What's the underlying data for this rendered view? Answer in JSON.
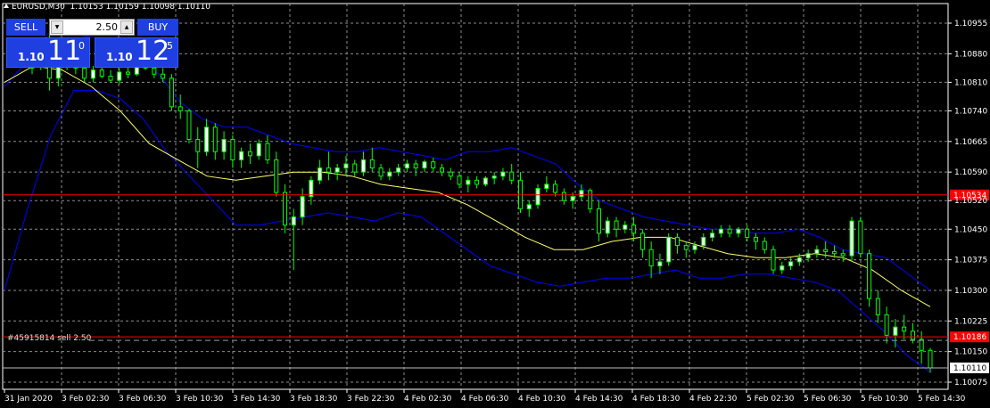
{
  "window": {
    "title": "EURUSD,M30  1.10153 1.10159 1.10098 1.10110"
  },
  "trade_panel": {
    "sell_label": "SELL",
    "buy_label": "BUY",
    "lot_value": "2.50",
    "sell_price": {
      "prefix": "1.10",
      "big": "11",
      "sup": "0"
    },
    "buy_price": {
      "prefix": "1.10",
      "big": "12",
      "sup": "5"
    }
  },
  "colors": {
    "background": "#000000",
    "grid": "#8c8c8c",
    "bull_candle": "#ffffff",
    "bear_candle": "#000000",
    "candle_outline": "#00ff00",
    "bollinger": "#0000ff",
    "moving_average": "#ffff66",
    "order_line": "#ff0000",
    "button": "#1f3fe0"
  },
  "chart_data": {
    "type": "candlestick",
    "symbol": "EURUSD",
    "timeframe": "M30",
    "ylim": [
      1.10075,
      1.10955
    ],
    "y_ticks": [
      "1.10955",
      "1.10880",
      "1.10810",
      "1.10740",
      "1.10665",
      "1.10590",
      "1.10520",
      "1.10450",
      "1.10375",
      "1.10300",
      "1.10225",
      "1.10150",
      "1.10075"
    ],
    "x_ticks": [
      "31 Jan 2020",
      "3 Feb 02:30",
      "3 Feb 06:30",
      "3 Feb 10:30",
      "3 Feb 14:30",
      "3 Feb 18:30",
      "3 Feb 22:30",
      "4 Feb 02:30",
      "4 Feb 06:30",
      "4 Feb 10:30",
      "4 Feb 14:30",
      "4 Feb 18:30",
      "4 Feb 22:30",
      "5 Feb 02:30",
      "5 Feb 06:30",
      "5 Feb 10:30",
      "5 Feb 14:30"
    ],
    "grid": true,
    "price_tags": [
      {
        "value": 1.10534,
        "label": "1.10534",
        "kind": "order-line"
      },
      {
        "value": 1.10186,
        "label": "1.10186",
        "kind": "order-line"
      },
      {
        "value": 1.1011,
        "label": "1.10110",
        "kind": "bid"
      }
    ],
    "order_label": "#45915814 sell 2.50",
    "candles": [
      [
        1.10845,
        1.1086,
        1.1083,
        1.1085
      ],
      [
        1.1085,
        1.10865,
        1.1084,
        1.10858
      ],
      [
        1.10875,
        1.10955,
        1.1079,
        1.1082
      ],
      [
        1.1082,
        1.1089,
        1.108,
        1.1087
      ],
      [
        1.1087,
        1.1088,
        1.1084,
        1.10855
      ],
      [
        1.10855,
        1.1087,
        1.1083,
        1.10845
      ],
      [
        1.10845,
        1.1086,
        1.1081,
        1.1082
      ],
      [
        1.1082,
        1.1085,
        1.1081,
        1.1084
      ],
      [
        1.1084,
        1.1085,
        1.1082,
        1.10825
      ],
      [
        1.10825,
        1.1084,
        1.1081,
        1.10815
      ],
      [
        1.10815,
        1.10845,
        1.10805,
        1.10835
      ],
      [
        1.10835,
        1.1086,
        1.1082,
        1.1083
      ],
      [
        1.1083,
        1.1087,
        1.10825,
        1.1086
      ],
      [
        1.1086,
        1.1087,
        1.1084,
        1.10845
      ],
      [
        1.10845,
        1.10855,
        1.1082,
        1.1083
      ],
      [
        1.1083,
        1.10845,
        1.1081,
        1.1082
      ],
      [
        1.1082,
        1.1083,
        1.1074,
        1.1075
      ],
      [
        1.1075,
        1.1078,
        1.1072,
        1.1074
      ],
      [
        1.1074,
        1.10745,
        1.1066,
        1.1067
      ],
      [
        1.1067,
        1.107,
        1.106,
        1.1064
      ],
      [
        1.1064,
        1.1072,
        1.1063,
        1.107
      ],
      [
        1.107,
        1.1071,
        1.1062,
        1.1064
      ],
      [
        1.1064,
        1.1069,
        1.1062,
        1.1067
      ],
      [
        1.1067,
        1.1068,
        1.106,
        1.1062
      ],
      [
        1.1062,
        1.1065,
        1.106,
        1.1064
      ],
      [
        1.1064,
        1.1066,
        1.1061,
        1.1063
      ],
      [
        1.1063,
        1.1067,
        1.1062,
        1.1066
      ],
      [
        1.1066,
        1.1068,
        1.1061,
        1.1062
      ],
      [
        1.1062,
        1.1064,
        1.1053,
        1.1054
      ],
      [
        1.1054,
        1.1056,
        1.1044,
        1.1046
      ],
      [
        1.1046,
        1.105,
        1.1035,
        1.1048
      ],
      [
        1.1048,
        1.1055,
        1.1046,
        1.1053
      ],
      [
        1.1053,
        1.1058,
        1.1051,
        1.1057
      ],
      [
        1.1057,
        1.1062,
        1.1056,
        1.106
      ],
      [
        1.106,
        1.1064,
        1.1057,
        1.1059
      ],
      [
        1.1059,
        1.1061,
        1.1057,
        1.106
      ],
      [
        1.106,
        1.1063,
        1.1058,
        1.1061
      ],
      [
        1.1061,
        1.1062,
        1.1058,
        1.1059
      ],
      [
        1.1059,
        1.1064,
        1.1058,
        1.1062
      ],
      [
        1.1062,
        1.1065,
        1.1059,
        1.106
      ],
      [
        1.106,
        1.1061,
        1.1057,
        1.1058
      ],
      [
        1.1058,
        1.106,
        1.1057,
        1.1059
      ],
      [
        1.1059,
        1.1061,
        1.1058,
        1.106
      ],
      [
        1.106,
        1.1062,
        1.1059,
        1.1061
      ],
      [
        1.1061,
        1.1062,
        1.1058,
        1.106
      ],
      [
        1.106,
        1.1062,
        1.1059,
        1.10615
      ],
      [
        1.10615,
        1.10625,
        1.1059,
        1.106
      ],
      [
        1.106,
        1.1061,
        1.1058,
        1.1059
      ],
      [
        1.1059,
        1.106,
        1.1057,
        1.1058
      ],
      [
        1.1058,
        1.1059,
        1.1055,
        1.1056
      ],
      [
        1.1056,
        1.1058,
        1.1054,
        1.1057
      ],
      [
        1.1057,
        1.1058,
        1.1055,
        1.1056
      ],
      [
        1.1056,
        1.1058,
        1.10555,
        1.10575
      ],
      [
        1.10575,
        1.1059,
        1.1056,
        1.1058
      ],
      [
        1.1058,
        1.106,
        1.1057,
        1.1059
      ],
      [
        1.1059,
        1.1061,
        1.1056,
        1.1057
      ],
      [
        1.1057,
        1.1059,
        1.1049,
        1.105
      ],
      [
        1.105,
        1.1052,
        1.1048,
        1.1051
      ],
      [
        1.1051,
        1.1056,
        1.105,
        1.1055
      ],
      [
        1.1055,
        1.1058,
        1.1054,
        1.1056
      ],
      [
        1.1056,
        1.1057,
        1.1053,
        1.1054
      ],
      [
        1.1054,
        1.1055,
        1.1051,
        1.1052
      ],
      [
        1.1052,
        1.1054,
        1.105,
        1.1053
      ],
      [
        1.1053,
        1.1056,
        1.1052,
        1.10545
      ],
      [
        1.10545,
        1.1055,
        1.1049,
        1.105
      ],
      [
        1.105,
        1.1052,
        1.1042,
        1.1044
      ],
      [
        1.1044,
        1.1048,
        1.1043,
        1.1047
      ],
      [
        1.1047,
        1.1048,
        1.1043,
        1.1045
      ],
      [
        1.1045,
        1.1047,
        1.1044,
        1.1046
      ],
      [
        1.1046,
        1.1048,
        1.1042,
        1.1044
      ],
      [
        1.1044,
        1.1045,
        1.1038,
        1.104
      ],
      [
        1.104,
        1.1042,
        1.1033,
        1.1036
      ],
      [
        1.1036,
        1.1039,
        1.1034,
        1.1037
      ],
      [
        1.1037,
        1.1044,
        1.1036,
        1.1043
      ],
      [
        1.1043,
        1.1044,
        1.1039,
        1.1041
      ],
      [
        1.1041,
        1.1042,
        1.1038,
        1.104
      ],
      [
        1.104,
        1.1042,
        1.1039,
        1.1041
      ],
      [
        1.1041,
        1.1044,
        1.104,
        1.1043
      ],
      [
        1.1043,
        1.1045,
        1.1042,
        1.1044
      ],
      [
        1.1044,
        1.1046,
        1.1043,
        1.1045
      ],
      [
        1.1045,
        1.1046,
        1.1043,
        1.1044
      ],
      [
        1.1044,
        1.10455,
        1.1043,
        1.1045
      ],
      [
        1.1045,
        1.1046,
        1.1042,
        1.1043
      ],
      [
        1.1043,
        1.1044,
        1.104,
        1.1042
      ],
      [
        1.1042,
        1.1043,
        1.1039,
        1.104
      ],
      [
        1.104,
        1.1041,
        1.1034,
        1.1035
      ],
      [
        1.1035,
        1.1037,
        1.1034,
        1.1036
      ],
      [
        1.1036,
        1.1038,
        1.1035,
        1.1037
      ],
      [
        1.1037,
        1.1039,
        1.1036,
        1.1038
      ],
      [
        1.1038,
        1.104,
        1.1037,
        1.1039
      ],
      [
        1.1039,
        1.1041,
        1.1038,
        1.104
      ],
      [
        1.104,
        1.1042,
        1.1038,
        1.10395
      ],
      [
        1.10395,
        1.1041,
        1.1038,
        1.1039
      ],
      [
        1.1039,
        1.104,
        1.1037,
        1.10385
      ],
      [
        1.10385,
        1.1048,
        1.1037,
        1.1047
      ],
      [
        1.1047,
        1.1048,
        1.1038,
        1.1039
      ],
      [
        1.1039,
        1.104,
        1.1026,
        1.1028
      ],
      [
        1.1028,
        1.103,
        1.1022,
        1.1024
      ],
      [
        1.1024,
        1.1026,
        1.1017,
        1.1019
      ],
      [
        1.1019,
        1.1023,
        1.1016,
        1.1021
      ],
      [
        1.1021,
        1.1024,
        1.1018,
        1.102
      ],
      [
        1.102,
        1.1022,
        1.1017,
        1.1018
      ],
      [
        1.1018,
        1.102,
        1.1012,
        1.10153
      ],
      [
        1.10153,
        1.10159,
        1.10098,
        1.1011
      ]
    ],
    "bollinger_upper": [
      1.108,
      1.1086,
      1.1093,
      1.1093,
      1.1092,
      1.109,
      1.1088,
      1.1083,
      1.1076,
      1.1072,
      1.107,
      1.107,
      1.1068,
      1.1066,
      1.1065,
      1.1064,
      1.1064,
      1.1065,
      1.1064,
      1.1063,
      1.1062,
      1.1064,
      1.1064,
      1.1065,
      1.1063,
      1.1061,
      1.1056,
      1.1052,
      1.105,
      1.1048,
      1.1047,
      1.1046,
      1.1045,
      1.1045,
      1.1044,
      1.1044,
      1.1045,
      1.1043,
      1.104,
      1.1039,
      1.1038,
      1.1034,
      1.103
    ],
    "bollinger_lower": [
      1.103,
      1.105,
      1.1068,
      1.1079,
      1.1079,
      1.1077,
      1.1072,
      1.1064,
      1.1058,
      1.1052,
      1.1046,
      1.1046,
      1.1047,
      1.1048,
      1.1049,
      1.1048,
      1.1047,
      1.1049,
      1.1048,
      1.1044,
      1.104,
      1.1036,
      1.1034,
      1.1032,
      1.1031,
      1.1032,
      1.1033,
      1.1033,
      1.1034,
      1.1035,
      1.1033,
      1.1033,
      1.1034,
      1.1034,
      1.1033,
      1.1032,
      1.103,
      1.1025,
      1.102,
      1.1014,
      1.101
    ],
    "moving_average": [
      1.1081,
      1.1085,
      1.1084,
      1.108,
      1.1074,
      1.1066,
      1.1062,
      1.1058,
      1.1057,
      1.1058,
      1.1059,
      1.1059,
      1.1058,
      1.1056,
      1.1055,
      1.1054,
      1.1051,
      1.1047,
      1.1043,
      1.104,
      1.104,
      1.1042,
      1.1043,
      1.1043,
      1.1041,
      1.1039,
      1.1038,
      1.1038,
      1.1039,
      1.1038,
      1.1035,
      1.103,
      1.1026
    ]
  }
}
